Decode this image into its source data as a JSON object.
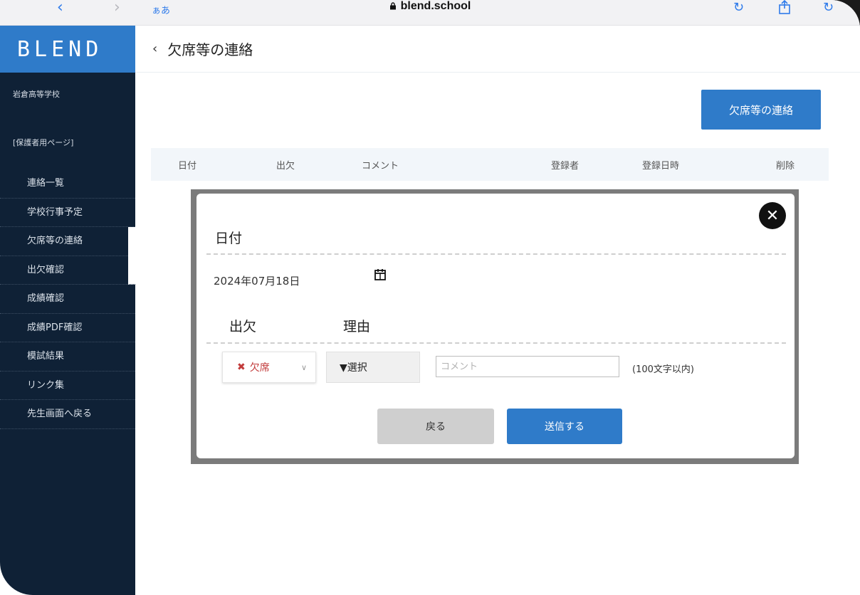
{
  "browser": {
    "text_size": "ぁあ",
    "url": "blend.school"
  },
  "sidebar": {
    "logo": "BLEND",
    "school_name": "岩倉高等学校",
    "section_title": "[保護者用ページ]",
    "items": [
      {
        "label": "連絡一覧"
      },
      {
        "label": "学校行事予定"
      },
      {
        "label": "欠席等の連絡"
      },
      {
        "label": "出欠確認"
      },
      {
        "label": "成績確認"
      },
      {
        "label": "成績PDF確認"
      },
      {
        "label": "模試結果"
      },
      {
        "label": "リンク集"
      },
      {
        "label": "先生画面へ戻る"
      }
    ]
  },
  "header": {
    "title": "欠席等の連絡"
  },
  "main": {
    "new_button": "欠席等の連絡",
    "table_headers": [
      "日付",
      "出欠",
      "コメント",
      "登録者",
      "登録日時",
      "削除"
    ]
  },
  "modal": {
    "date_label": "日付",
    "date_value": "2024年07月18日",
    "attendance_label": "出欠",
    "reason_label": "理由",
    "attendance_value": "欠席",
    "reason_value": "▼選択",
    "comment_placeholder": "コメント",
    "limit_note": "(100文字以内)",
    "back_button": "戻る",
    "send_button": "送信する"
  }
}
